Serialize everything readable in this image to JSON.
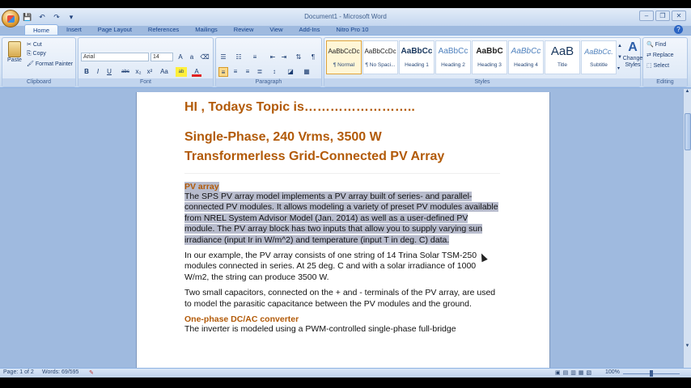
{
  "window": {
    "title": "Document1 - Microsoft Word",
    "controls": [
      "–",
      "❐",
      "✕"
    ]
  },
  "quick_access": [
    "💾",
    "↶",
    "↷",
    "▾"
  ],
  "tabs": [
    "Home",
    "Insert",
    "Page Layout",
    "References",
    "Mailings",
    "Review",
    "View",
    "Add-Ins",
    "Nitro Pro 10"
  ],
  "ribbon": {
    "clipboard": {
      "label": "Clipboard",
      "paste": "Paste",
      "cut": "Cut",
      "copy": "Copy",
      "format_painter": "Format Painter"
    },
    "font": {
      "label": "Font",
      "font_name": "Arial",
      "font_size": "14",
      "buttons": [
        "B",
        "I",
        "U",
        "abc",
        "x₂",
        "x²",
        "Aa",
        "ab",
        "A"
      ]
    },
    "paragraph": {
      "label": "Paragraph"
    },
    "styles": {
      "label": "Styles",
      "items": [
        {
          "sample": "AaBbCcDc",
          "name": "¶ Normal"
        },
        {
          "sample": "AaBbCcDc",
          "name": "¶ No Spaci..."
        },
        {
          "sample": "AaBbCc",
          "name": "Heading 1"
        },
        {
          "sample": "AaBbCc",
          "name": "Heading 2"
        },
        {
          "sample": "AaBbC",
          "name": "Heading 3"
        },
        {
          "sample": "AaBbCc",
          "name": "Heading 4"
        },
        {
          "sample": "AaB",
          "name": "Title"
        },
        {
          "sample": "AaBbCc.",
          "name": "Subtitle"
        }
      ],
      "change_styles": "Change Styles"
    },
    "editing": {
      "label": "Editing",
      "find": "Find",
      "replace": "Replace",
      "select": "Select"
    }
  },
  "document": {
    "heading_line1": "HI , Todays Topic is……………………..",
    "heading_line2": "Single-Phase, 240 Vrms, 3500 W",
    "heading_line3": "Transformerless Grid-Connected PV Array",
    "section1_title": "PV array",
    "section1_para": "The SPS PV array model implements a PV array built of series- and parallel-connected PV modules. It allows modeling a variety of preset PV modules available from NREL System Advisor Model (Jan. 2014) as well as a user-defined PV module. The PV array block has two inputs that allow you to supply varying sun irradiance (input Ir in W/m^2) and temperature (input T in deg. C) data.",
    "para2": "In our example, the PV array consists of one string of 14 Trina Solar TSM-250 modules connected in series. At 25 deg. C and with a solar irradiance of 1000 W/m2, the string can produce 3500 W.",
    "para3": "Two small capacitors, connected on the + and - terminals of the PV array, are used to model the parasitic capacitance between the PV modules and the ground.",
    "section2_title": "One-phase DC/AC converter",
    "para4": "The inverter is modeled using a PWM-controlled single-phase full-bridge"
  },
  "status": {
    "page": "Page: 1 of 2",
    "words": "Words: 69/595",
    "zoom": "100%"
  }
}
